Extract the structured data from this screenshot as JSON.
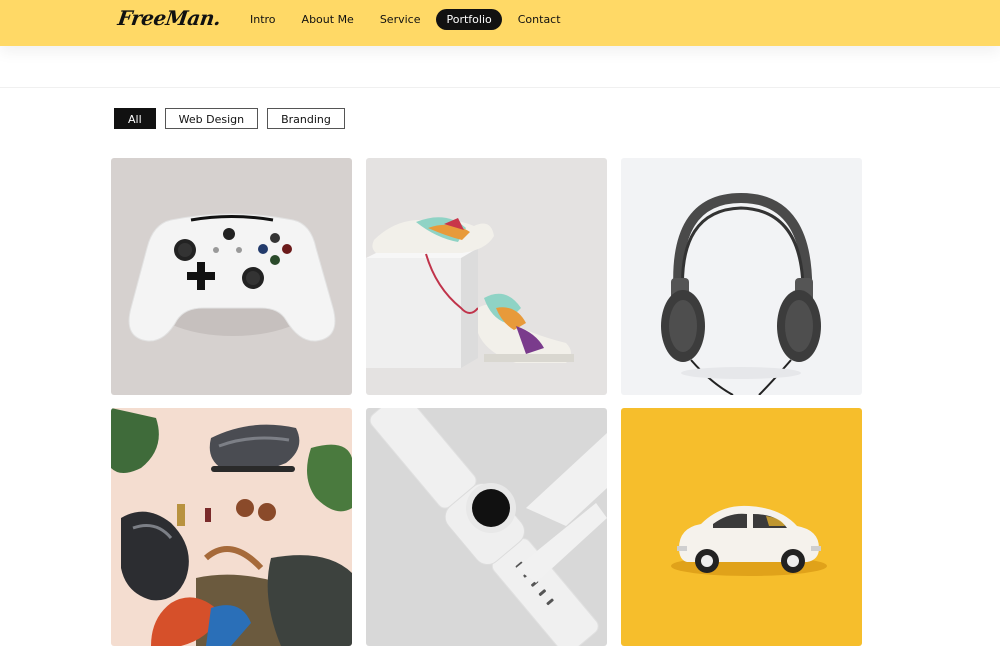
{
  "brand": {
    "logo_text": "FreeMan."
  },
  "nav": {
    "items": [
      {
        "label": "Intro"
      },
      {
        "label": "About Me"
      },
      {
        "label": "Service"
      },
      {
        "label": "Portfolio",
        "active": true
      },
      {
        "label": "Contact"
      }
    ]
  },
  "filters": {
    "items": [
      {
        "label": "All",
        "active": true
      },
      {
        "label": "Web Design"
      },
      {
        "label": "Branding"
      }
    ]
  },
  "portfolio": {
    "items": [
      {
        "subject": "game-controller",
        "background": "#d6d1cf"
      },
      {
        "subject": "sneakers",
        "background": "#e4e2e1"
      },
      {
        "subject": "headphones",
        "background": "#f2f3f5"
      },
      {
        "subject": "flatlay-shoes-bag",
        "background": "#f4ddd0"
      },
      {
        "subject": "smartwatch",
        "background": "#d8d8d8"
      },
      {
        "subject": "toy-car",
        "background": "#f6be2c"
      }
    ]
  },
  "colors": {
    "header": "#ffd966",
    "accent": "#111111"
  }
}
